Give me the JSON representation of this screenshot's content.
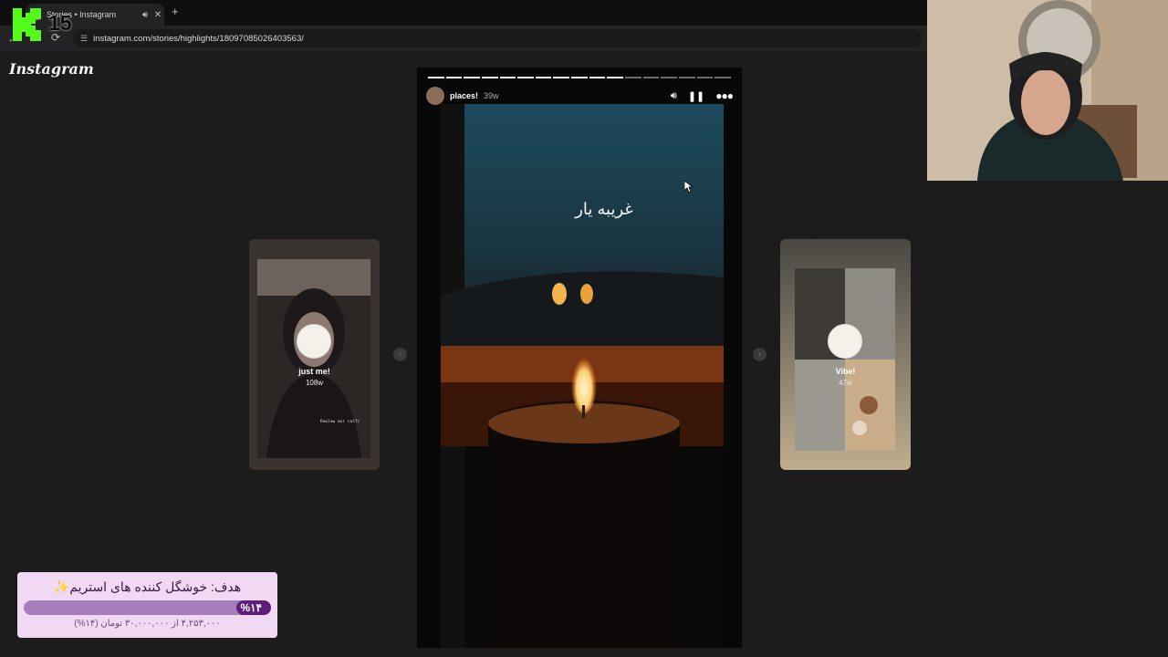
{
  "browser": {
    "tab_title": "Stories • Instagram",
    "url": "instagram.com/stories/highlights/18097085026403563/"
  },
  "overlay": {
    "counter": "15",
    "accent_color": "#53fc18"
  },
  "instagram": {
    "logo": "Instagram",
    "story": {
      "user": "places!",
      "age": "39w",
      "text": "غریبه یار",
      "segments_total": 17,
      "segments_done": 11
    },
    "prev_highlight": {
      "title": "just me!",
      "age": "108w",
      "caption": "Rowlaw aur calf/"
    },
    "next_highlight": {
      "title": "Vibe!",
      "age": "47w"
    }
  },
  "goal": {
    "title": "هدف: خوشگل کننده های استریم✨",
    "percent_label": "%۱۴",
    "progress": 0.14,
    "amount": "۴,۲۵۳,۰۰۰ از ۳۰,۰۰۰,۰۰۰ تومان (۱۴%)"
  }
}
